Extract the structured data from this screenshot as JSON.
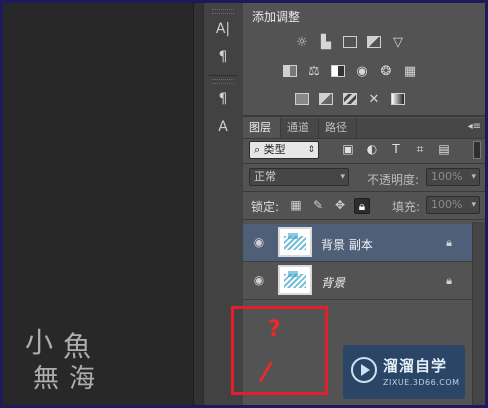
{
  "adjustments": {
    "title": "添加调整",
    "icons_row1": [
      "brightness-contrast-icon",
      "levels-icon",
      "curves-icon",
      "exposure-icon",
      "vibrance-icon"
    ],
    "icons_row2": [
      "hue-saturation-icon",
      "color-balance-icon",
      "black-white-icon",
      "photo-filter-icon",
      "channel-mixer-icon",
      "color-lookup-icon"
    ],
    "icons_row3": [
      "invert-icon",
      "posterize-icon",
      "threshold-icon",
      "selective-color-icon",
      "gradient-map-icon"
    ]
  },
  "tabs": [
    {
      "label": "图层",
      "active": true
    },
    {
      "label": "通道",
      "active": false
    },
    {
      "label": "路径",
      "active": false
    }
  ],
  "filter": {
    "kind_label": "类型"
  },
  "blend": {
    "mode": "正常",
    "opacity_label": "不透明度:",
    "opacity_value": "100%"
  },
  "lock": {
    "label": "锁定:",
    "fill_label": "填充:",
    "fill_value": "100%"
  },
  "layers": [
    {
      "name": "背景 副本",
      "selected": true,
      "italic": false
    },
    {
      "name": "背景",
      "selected": false,
      "italic": true
    }
  ],
  "annotation": {
    "question": "?",
    "slash": "/"
  },
  "watermark_left": {
    "c1": "小",
    "c2": "魚",
    "c3": "無",
    "c4": "海"
  },
  "watermark_right": {
    "brand": "溜溜自学",
    "url": "ZIXUE.3D66.COM"
  },
  "colors": {
    "panel": "#535353",
    "selected_layer": "#4e5f77",
    "annotation_red": "#e3202a",
    "border": "#1d1a5a"
  }
}
